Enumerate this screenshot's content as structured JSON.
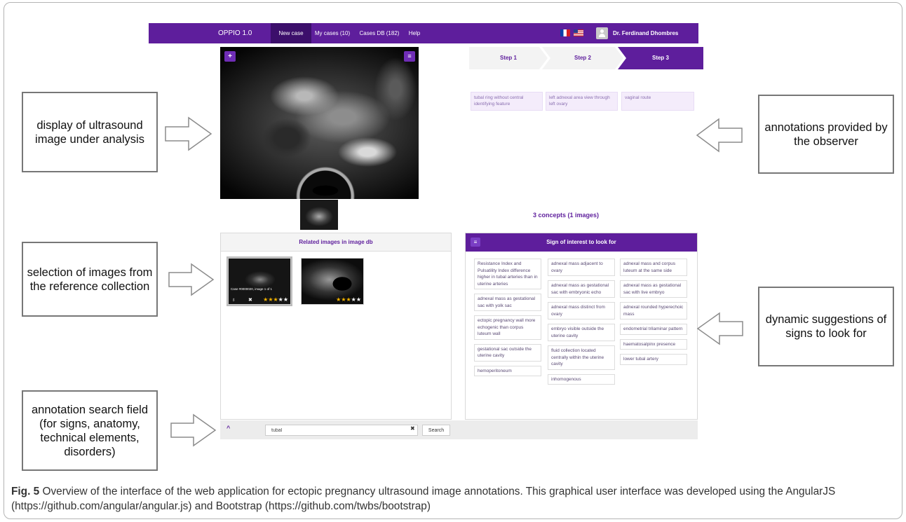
{
  "navbar": {
    "brand": "OPPIO 1.0",
    "tabs": [
      "New case",
      "My cases (10)",
      "Cases DB (182)",
      "Help"
    ],
    "active_tab": "New case",
    "user_name": "Dr. Ferdinand Dhombres"
  },
  "image_panel": {
    "add_icon": "plus-icon",
    "list_icon": "list-icon",
    "add_glyph": "+",
    "list_glyph": "≡"
  },
  "related": {
    "title": "Related images in image db",
    "thumbs": [
      {
        "label": "Case #0000020, image 1 of 1",
        "rating": 3,
        "max": 5
      },
      {
        "label": "",
        "rating": 3,
        "max": 5
      }
    ]
  },
  "stepper": {
    "steps": [
      "Step 1",
      "Step 2",
      "Step 3"
    ],
    "active": "Step 3"
  },
  "annotations": [
    "tubal ring without central identifying feature",
    "left adnexal area view through left ovary",
    "vaginal route"
  ],
  "concept_count": "3 concepts (1 images)",
  "signs": {
    "title": "Sign of interest to look for",
    "columns": [
      [
        "Resistance Index and Pulsatility Index difference higher in tubal arteries than in uterine arteries",
        "adnexal mass as gestational sac with yolk sac",
        "ectopic pregnancy wall more echogenic than corpus luteum wall",
        "gestational sac outside the uterine cavity",
        "hemoperitoneum"
      ],
      [
        "adnexal mass adjacent to ovary",
        "adnexal mass as gestational sac with embryonic echo",
        "adnexal mass distinct from ovary",
        "embryo visible outside the uterine cavity",
        "fluid collection located centrally within the uterine cavity",
        "inhomogenous"
      ],
      [
        "adnexal mass and corpus luteum at the same side",
        "adnexal mass as gestational sac with live embryo",
        "adnexal rounded hyperechoic mass",
        "endometrial trilaminar pattern",
        "haematosalpinx presence",
        "lower tubal artery"
      ]
    ]
  },
  "search": {
    "value": "tubal",
    "clear_glyph": "✖",
    "button": "Search",
    "collapse_glyph": "^"
  },
  "callouts": {
    "display": "display of ultrasound image under analysis",
    "selection": "selection of images from the reference collection",
    "search": "annotation search field (for signs, anatomy, technical elements, disorders)",
    "annotations": "annotations provided by the observer",
    "suggestions": "dynamic suggestions of signs to look for"
  },
  "caption": {
    "label": "Fig. 5",
    "text": " Overview of the interface of the web application for ectopic pregnancy ultrasound image annotations. This graphical user interface was developed using the AngularJS (https://github.com/angular/angular.js) and Bootstrap (https://github.com/twbs/bootstrap)"
  },
  "colors": {
    "brand_purple": "#5e1e9c",
    "star": "#f4b400",
    "chip_bg": "#f4ecfb"
  }
}
